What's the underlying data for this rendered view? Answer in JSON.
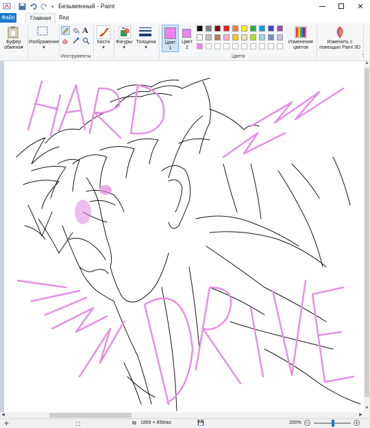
{
  "window": {
    "title": "Безымянный - Paint"
  },
  "tabs": {
    "file": "Файл",
    "home": "Главная",
    "view": "Вид"
  },
  "ribbon": {
    "clipboard_line1": "Буфер",
    "clipboard_line2": "обмена",
    "image": "Изображение",
    "tools_group": "Инструменты",
    "brushes": "Кисти",
    "shapes": "Фигуры",
    "size": "Толщина",
    "color1_line1": "Цвет",
    "color1_line2": "1",
    "color2_line1": "Цвет",
    "color2_line2": "2",
    "edit_colors_line1": "Изменение",
    "edit_colors_line2": "цветов",
    "paint3d_line1": "Изменить с",
    "paint3d_line2": "помощью Paint 3D",
    "colors_group": "Цвета"
  },
  "palette": {
    "row1": [
      "#000000",
      "#7f7f7f",
      "#880015",
      "#ed1c24",
      "#ff7f27",
      "#fff200",
      "#22b14c",
      "#00a2e8",
      "#3f48cc",
      "#a349a4"
    ],
    "row2": [
      "#ffffff",
      "#c3c3c3",
      "#b97a57",
      "#ffaec9",
      "#ffc90e",
      "#efe4b0",
      "#b5e61d",
      "#99d9ea",
      "#7092be",
      "#c8bfe7"
    ],
    "color1": "#ee82ee",
    "color2": "#ee82ee"
  },
  "canvas_art": {
    "stroke_pink": "#e68ee6",
    "stroke_black": "#111111",
    "blush": "#e08ad8"
  },
  "status": {
    "image_size": "1869 × 856пкс",
    "zoom": "200%"
  }
}
